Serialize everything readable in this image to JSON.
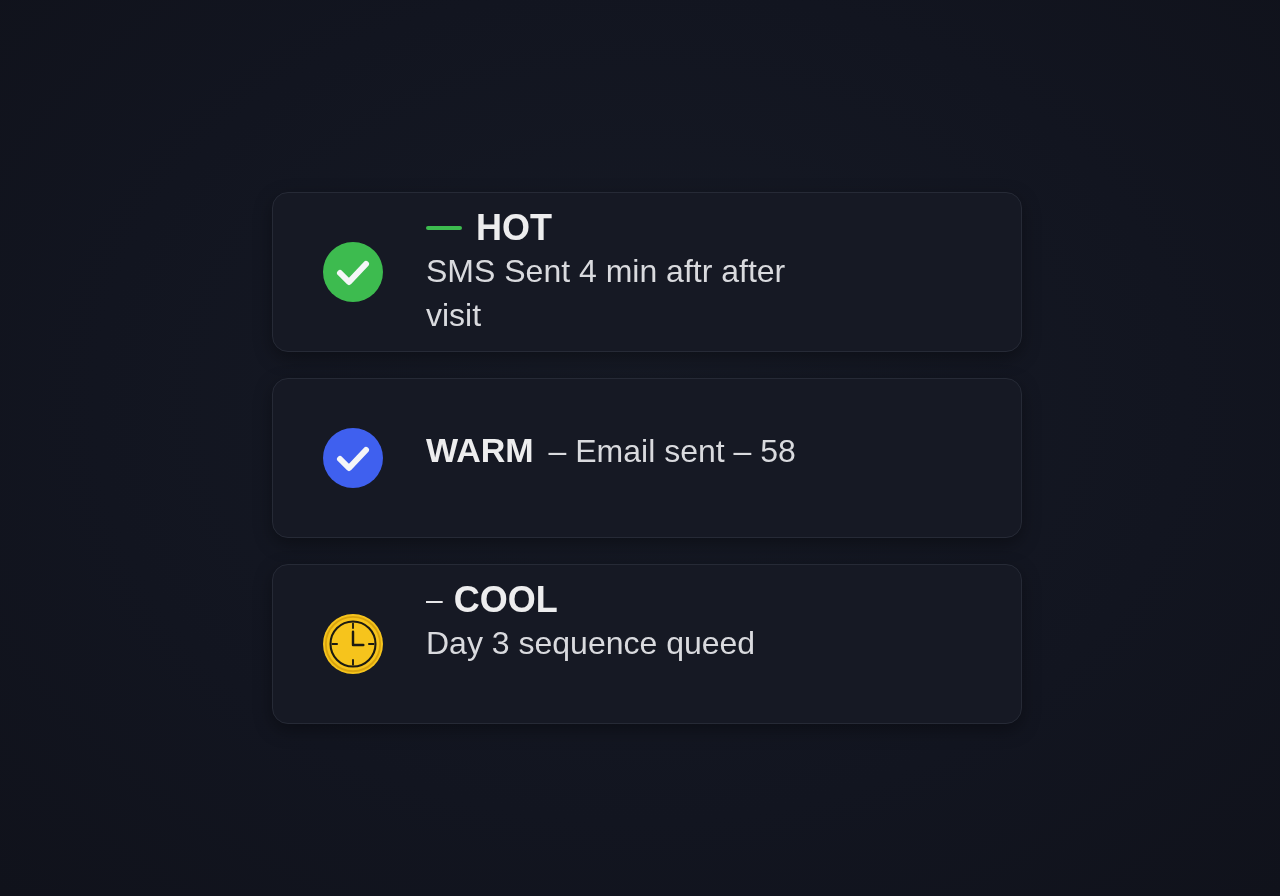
{
  "leads": [
    {
      "kind": "sent",
      "color": "#3dbb4f",
      "accent_bar": true,
      "tier": "HOT",
      "detail": "SMS Sent 4 min aftr after visit"
    },
    {
      "kind": "sent",
      "color": "#3f60ef",
      "accent_bar": false,
      "summary": "**WARM** – Email sent – 58"
    },
    {
      "kind": "queued",
      "color": "#f6c41c",
      "accent_bar": false,
      "prefix": "–",
      "tier": "COOL",
      "detail": "Day 3 sequence queed"
    }
  ]
}
